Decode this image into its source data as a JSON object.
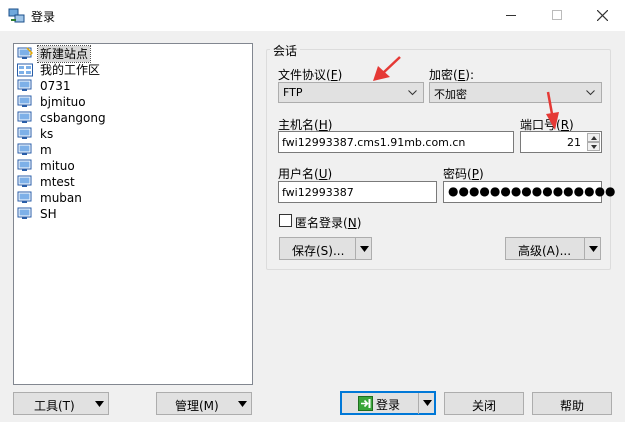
{
  "window": {
    "title": "登录"
  },
  "tree": {
    "items": [
      {
        "label": "新建站点",
        "icon": "new-site-icon",
        "selected": true
      },
      {
        "label": "我的工作区",
        "icon": "workspace-icon"
      },
      {
        "label": "0731",
        "icon": "monitor-icon"
      },
      {
        "label": "bjmituo",
        "icon": "monitor-icon"
      },
      {
        "label": "csbangong",
        "icon": "monitor-icon"
      },
      {
        "label": "ks",
        "icon": "monitor-icon"
      },
      {
        "label": "m",
        "icon": "monitor-icon"
      },
      {
        "label": "mituo",
        "icon": "monitor-icon"
      },
      {
        "label": "mtest",
        "icon": "monitor-icon"
      },
      {
        "label": "muban",
        "icon": "monitor-icon"
      },
      {
        "label": "SH",
        "icon": "monitor-icon"
      }
    ]
  },
  "session": {
    "group_title": "会话",
    "protocol": {
      "label": "文件协议",
      "hotkey": "F",
      "value": "FTP"
    },
    "encryption": {
      "label": "加密",
      "hotkey": "E",
      "suffix": ":",
      "value": "不加密"
    },
    "host": {
      "label": "主机名",
      "hotkey": "H",
      "value": "fwi12993387.cms1.91mb.com.cn"
    },
    "port": {
      "label": "端口号",
      "hotkey": "R",
      "value": "21"
    },
    "user": {
      "label": "用户名",
      "hotkey": "U",
      "value": "fwi12993387"
    },
    "password": {
      "label": "密码",
      "hotkey": "P",
      "value": "●●●●●●●●●●●●●●●●"
    },
    "anonymous": {
      "label": "匿名登录",
      "hotkey": "N"
    },
    "save_button": {
      "label": "保存(S)..."
    },
    "advanced_button": {
      "label": "高级(A)..."
    }
  },
  "footer": {
    "tools_button": "工具(T)",
    "manage_button": "管理(M)",
    "login_button": "登录",
    "close_button": "关闭",
    "help_button": "帮助"
  },
  "colors": {
    "accent": "#0078d7",
    "annotation": "#e53935",
    "login_icon": "#3aa53a"
  }
}
